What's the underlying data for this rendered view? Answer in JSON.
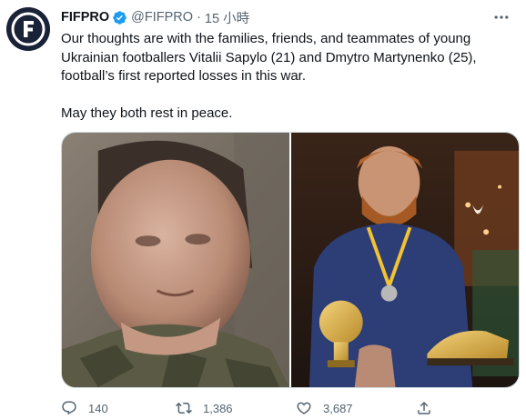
{
  "tweet": {
    "display_name": "FIFPRO",
    "handle": "@FIFPRO",
    "separator": "·",
    "time": "15 小時",
    "text_lines": [
      "Our thoughts are with the families, friends, and teammates of young Ukrainian footballers Vitalii Sapylo (21) and Dmytro Martynenko (25), football’s first reported losses in this war.",
      "May they both rest in peace."
    ],
    "avatar_icon": "fifpro-logo",
    "verified_icon": "verified-badge-icon",
    "more_icon": "more-options-icon",
    "media": [
      {
        "icon": "photo-young-man-portrait"
      },
      {
        "icon": "photo-footballer-with-trophies"
      }
    ]
  },
  "actions": {
    "reply_count": "140",
    "retweet_count": "1,386",
    "like_count": "3,687"
  },
  "colors": {
    "text": "#0f1419",
    "secondary": "#536471",
    "verified": "#1d9bf0",
    "avatar_bg": "#1a2238"
  }
}
